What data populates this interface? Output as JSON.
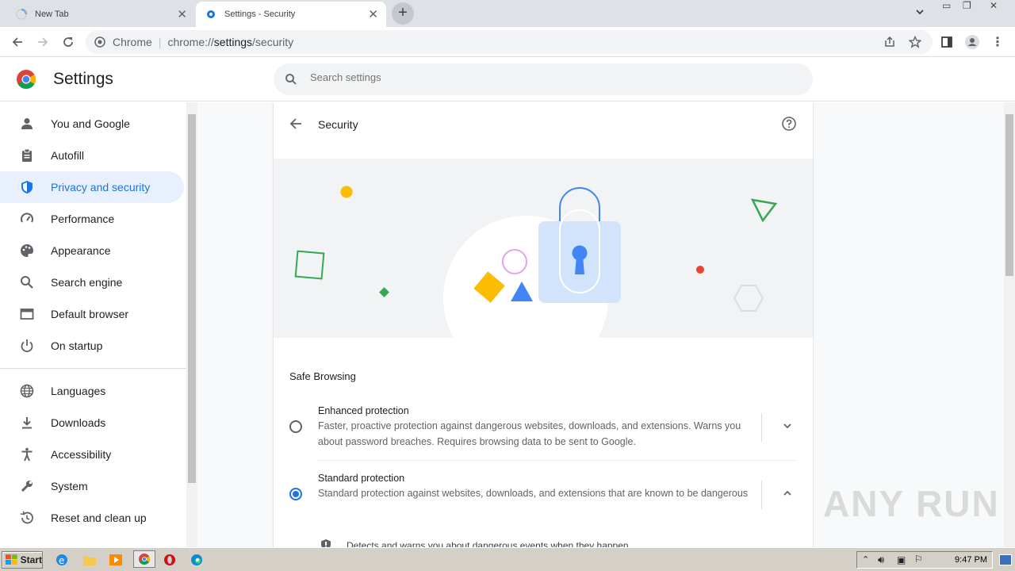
{
  "tabs": [
    {
      "title": "New Tab",
      "active": false
    },
    {
      "title": "Settings - Security",
      "active": true
    }
  ],
  "omnibox": {
    "chip": "Chrome",
    "url_prefix": "chrome://",
    "url_host": "settings",
    "url_path": "/security"
  },
  "header": {
    "title": "Settings",
    "search_placeholder": "Search settings"
  },
  "sidebar": {
    "items": [
      {
        "label": "You and Google",
        "icon": "person-icon"
      },
      {
        "label": "Autofill",
        "icon": "clipboard-icon"
      },
      {
        "label": "Privacy and security",
        "icon": "shield-icon",
        "selected": true
      },
      {
        "label": "Performance",
        "icon": "speedometer-icon"
      },
      {
        "label": "Appearance",
        "icon": "palette-icon"
      },
      {
        "label": "Search engine",
        "icon": "search-icon"
      },
      {
        "label": "Default browser",
        "icon": "browser-icon"
      },
      {
        "label": "On startup",
        "icon": "power-icon"
      },
      {
        "label": "Languages",
        "icon": "globe-icon"
      },
      {
        "label": "Downloads",
        "icon": "download-icon"
      },
      {
        "label": "Accessibility",
        "icon": "accessibility-icon"
      },
      {
        "label": "System",
        "icon": "wrench-icon"
      },
      {
        "label": "Reset and clean up",
        "icon": "history-icon"
      }
    ]
  },
  "page": {
    "title": "Security",
    "section": "Safe Browsing",
    "options": [
      {
        "title": "Enhanced protection",
        "desc": "Faster, proactive protection against dangerous websites, downloads, and extensions. Warns you about password breaches. Requires browsing data to be sent to Google.",
        "selected": false,
        "expanded": false
      },
      {
        "title": "Standard protection",
        "desc": "Standard protection against websites, downloads, and extensions that are known to be dangerous",
        "selected": true,
        "expanded": true
      }
    ],
    "detail": "Detects and warns you about dangerous events when they happen"
  },
  "watermark": "ANY RUN",
  "taskbar": {
    "start": "Start",
    "time": "9:47 PM"
  },
  "colors": {
    "accent": "#1a73e8",
    "selected_bg": "#e8f0fe"
  }
}
